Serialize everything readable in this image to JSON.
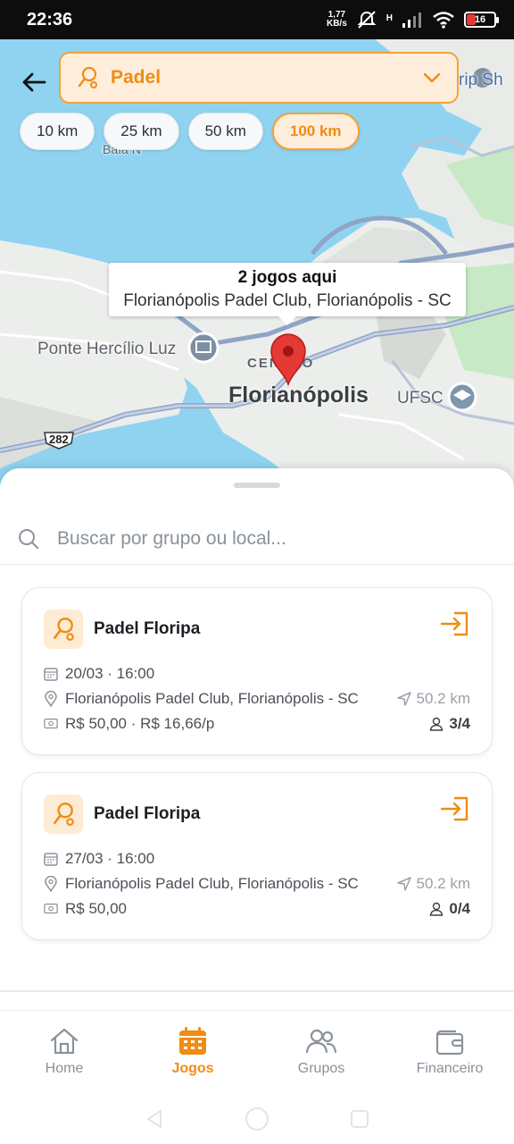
{
  "status_bar": {
    "time": "22:36",
    "net_speed": "1,77",
    "net_unit": "KB/s",
    "net_type": "H",
    "battery": "16",
    "battery_color": "#e53935"
  },
  "map": {
    "labels": {
      "bridge": "Ponte Hercílio Luz",
      "centro": "CENTRO",
      "city": "Florianópolis",
      "ufsc": "UFSC",
      "road": "282",
      "bay": "Baía N",
      "top_right": "rip Sh"
    },
    "tooltip": {
      "title": "2 jogos aqui",
      "subtitle": "Florianópolis Padel Club, Florianópolis - SC"
    },
    "pin_color": "#e53935"
  },
  "filter": {
    "sport": "Padel",
    "radius_options": [
      "10 km",
      "25 km",
      "50 km",
      "100 km"
    ],
    "selected_radius": "100 km"
  },
  "search": {
    "placeholder": "Buscar por grupo ou local..."
  },
  "games": [
    {
      "group": "Padel Floripa",
      "datetime": "20/03 · 16:00",
      "location": "Florianópolis Padel Club, Florianópolis - SC",
      "distance": "50.2 km",
      "price": "R$ 50,00 · R$ 16,66/p",
      "players": "3/4"
    },
    {
      "group": "Padel Floripa",
      "datetime": "27/03 · 16:00",
      "location": "Florianópolis Padel Club, Florianópolis - SC",
      "distance": "50.2 km",
      "price": "R$ 50,00",
      "players": "0/4"
    }
  ],
  "bottom_nav": {
    "items": [
      {
        "label": "Home",
        "icon": "home-icon",
        "active": false
      },
      {
        "label": "Jogos",
        "icon": "calendar-icon",
        "active": true
      },
      {
        "label": "Grupos",
        "icon": "groups-icon",
        "active": false
      },
      {
        "label": "Financeiro",
        "icon": "wallet-icon",
        "active": false
      }
    ]
  },
  "colors": {
    "accent": "#f08c14",
    "accent_light": "#ffeedb",
    "water": "#8fd3f0",
    "land": "#eef0ee"
  }
}
